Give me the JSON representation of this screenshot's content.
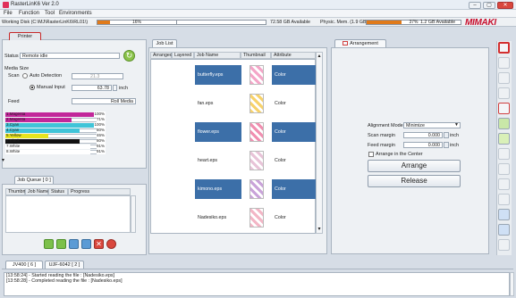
{
  "window": {
    "title": "RasterLinK6 Ver 2.0",
    "min": "–",
    "max": "▢",
    "close": "✕"
  },
  "menu": [
    "File",
    "Function",
    "Tool",
    "Environments"
  ],
  "status": {
    "working_disk": "Working Disk (C:\\MJ\\RasterLinK6\\RL01\\)",
    "disk_pct": "16%",
    "disk_fill": 0.16,
    "disk_available": "72.58 GB Available",
    "physic_mem": "Physic. Mem. (1.9 GB)",
    "mem_pct": "37%",
    "mem_fill": 0.37,
    "mem_available": "1.2 GB Available"
  },
  "brand_logo": "MIMAKI",
  "printer": {
    "tab": "Printer",
    "status_label": "Status",
    "status_value": "Remote idle",
    "media_size_label": "Media Size",
    "scan_label": "Scan",
    "auto_detection": "Auto Detection",
    "auto_value": "21.3",
    "manual_input": "Manual Input",
    "manual_value": "63.78",
    "unit": "inch",
    "feed_label": "Feed",
    "feed_value": "Roll Media",
    "inks": [
      {
        "name": "1.Magenta",
        "pct": "100%",
        "fill": 1.0,
        "color": "#c2279a"
      },
      {
        "name": "2.Magenta",
        "pct": "71%",
        "fill": 0.71,
        "color": "#c2279a"
      },
      {
        "name": "3.Cyan",
        "pct": "100%",
        "fill": 1.0,
        "color": "#40c4d8"
      },
      {
        "name": "4.Cyan",
        "pct": "80%",
        "fill": 0.8,
        "color": "#40c4d8"
      },
      {
        "name": "5.Yellow",
        "pct": "46%",
        "fill": 0.46,
        "color": "#e8e41e"
      },
      {
        "name": "6.Black",
        "pct": "80%",
        "fill": 0.8,
        "color": "#111111"
      },
      {
        "name": "7.White",
        "pct": "91%",
        "fill": 0.91,
        "color": "#ffffff"
      },
      {
        "name": "8.White",
        "pct": "91%",
        "fill": 0.91,
        "color": "#ffffff"
      }
    ]
  },
  "job_queue": {
    "tab": "Job Queue [ 0 ]",
    "columns": [
      "Thumbnail",
      "Job Name",
      "Status",
      "Progress"
    ]
  },
  "job_list": {
    "tab": "Job List",
    "columns": [
      "Arranged",
      "Layered",
      "Job Name",
      "Thumbnail",
      "Attribute"
    ],
    "rows": [
      {
        "name": "butterfly.eps",
        "attr": "Color",
        "selected": true
      },
      {
        "name": "fan.eps",
        "attr": "Color",
        "selected": false
      },
      {
        "name": "flower.eps",
        "attr": "Color",
        "selected": true
      },
      {
        "name": "heart.eps",
        "attr": "Color",
        "selected": false
      },
      {
        "name": "kimono.eps",
        "attr": "Color",
        "selected": true
      },
      {
        "name": "Nadesiko.eps",
        "attr": "Color",
        "selected": false
      }
    ]
  },
  "arrangement": {
    "tab": "Arrangement",
    "alignment_label": "Alignment Mode",
    "alignment_value": "Minimize",
    "scan_margin_label": "Scan margin",
    "scan_margin_value": "0.000",
    "feed_margin_label": "Feed margin",
    "feed_margin_value": "0.000",
    "unit": "inch",
    "center_label": "Arrange in the Center",
    "arrange_button": "Arrange",
    "release_button": "Release"
  },
  "printer_tabs": [
    "JV400 [ 6 ]",
    "UJF-6042 [ 2 ]"
  ],
  "log": [
    "[13:58:24] - Started reading the file : [Nadesiko.eps]",
    "[13:58:28] - Completed reading the file : [Nadesiko.eps]"
  ],
  "colors": {
    "accent_selected": "#3c6fa8",
    "meter_fill": "#e07a1a",
    "logo": "#c8102e"
  }
}
